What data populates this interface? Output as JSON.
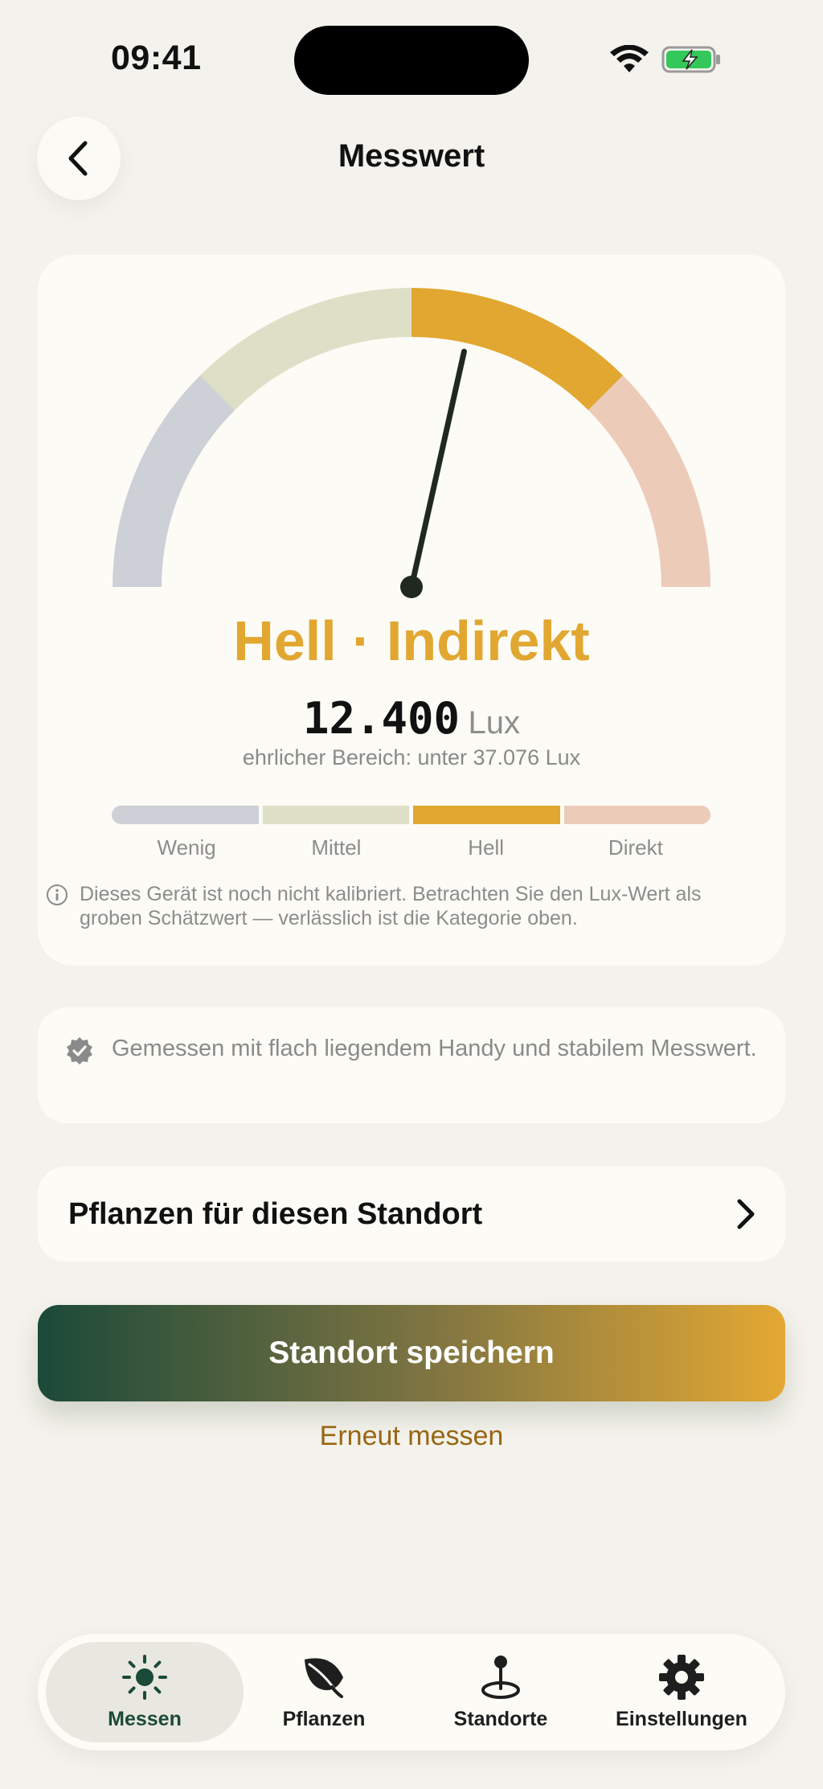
{
  "status_bar": {
    "time": "09:41"
  },
  "header": {
    "title": "Messwert"
  },
  "gauge": {
    "needle_fraction": 0.57,
    "zones": [
      {
        "name": "Wenig",
        "color": "#CDD0D6"
      },
      {
        "name": "Mittel",
        "color": "#DDE0C7"
      },
      {
        "name": "Hell",
        "color": "#E1A730"
      },
      {
        "name": "Direkt",
        "color": "#EDCBB9"
      }
    ],
    "needle_color": "#20291F"
  },
  "reading": {
    "label": "Hell · Indirekt",
    "value": "12.400",
    "unit": "Lux",
    "range_text": "ehrlicher Bereich: unter 37.076 Lux"
  },
  "scale": {
    "labels": [
      "Wenig",
      "Mittel",
      "Hell",
      "Direkt"
    ],
    "colors": [
      "#CDD0D6",
      "#DDE0C7",
      "#E1A730",
      "#EDCBB9"
    ]
  },
  "calibration_note": "Dieses Gerät ist noch nicht kalibriert. Betrachten Sie den Lux-Wert als groben Schätzwert — verlässlich ist die Kategorie oben.",
  "measurement_info": "Gemessen mit flach liegendem Handy und stabilem Messwert.",
  "plants_link": {
    "label": "Pflanzen für diesen Standort"
  },
  "actions": {
    "save_label": "Standort speichern",
    "remeasure_label": "Erneut messen"
  },
  "tabs": [
    {
      "label": "Messen",
      "icon": "sun-icon",
      "active": true
    },
    {
      "label": "Pflanzen",
      "icon": "leaf-icon",
      "active": false
    },
    {
      "label": "Standorte",
      "icon": "location-pin-icon",
      "active": false
    },
    {
      "label": "Einstellungen",
      "icon": "gear-icon",
      "active": false
    }
  ],
  "colors": {
    "accent": "#E1A730",
    "brand_green": "#1B4A39",
    "background": "#F3F2EC",
    "card": "#FCFBF5"
  }
}
